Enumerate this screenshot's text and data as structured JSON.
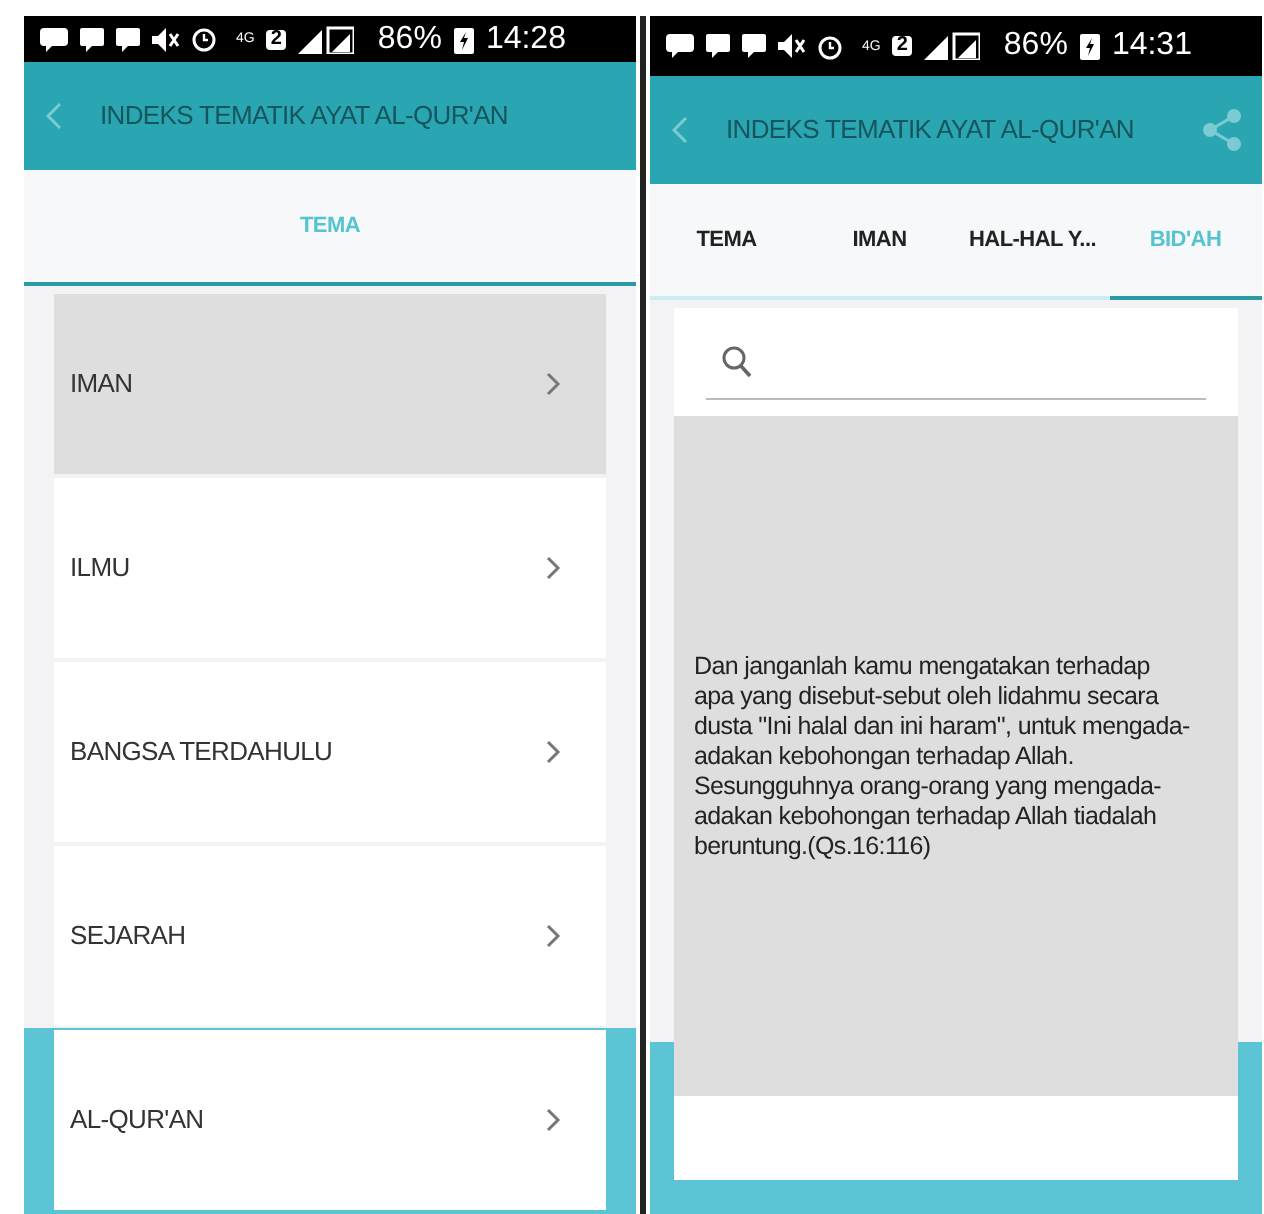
{
  "screens": [
    {
      "status_bar": {
        "network": "4G",
        "sim": "2",
        "battery": "86%",
        "time": "14:28"
      },
      "app_bar": {
        "title": "INDEKS TEMATIK AYAT AL-QUR'AN",
        "share": false
      },
      "tabs": [
        {
          "label": "TEMA",
          "selected": true
        }
      ],
      "content": {
        "kind": "list",
        "items": [
          {
            "label": "IMAN",
            "selected": true
          },
          {
            "label": "ILMU",
            "selected": false
          },
          {
            "label": "BANGSA TERDAHULU",
            "selected": false
          },
          {
            "label": "SEJARAH",
            "selected": false
          },
          {
            "label": "AL-QUR'AN",
            "selected": false
          }
        ]
      }
    },
    {
      "status_bar": {
        "network": "4G",
        "sim": "2",
        "battery": "86%",
        "time": "14:31"
      },
      "app_bar": {
        "title": "INDEKS TEMATIK AYAT AL-QUR'AN",
        "share": true
      },
      "tabs": [
        {
          "label": "TEMA",
          "selected": false
        },
        {
          "label": "IMAN",
          "selected": false
        },
        {
          "label": "HAL-HAL Y...",
          "selected": false
        },
        {
          "label": "BID'AH",
          "selected": true
        }
      ],
      "content": {
        "kind": "detail",
        "text": "Dan janganlah kamu mengatakan terhadap apa yang disebut-sebut oleh lidahmu secara dusta \"Ini halal dan ini haram\", untuk mengada-adakan kebohongan terhadap Allah. Sesungguhnya orang-orang yang mengada-adakan kebohongan terhadap Allah tiadalah beruntung.(Qs.16:116)"
      }
    }
  ]
}
